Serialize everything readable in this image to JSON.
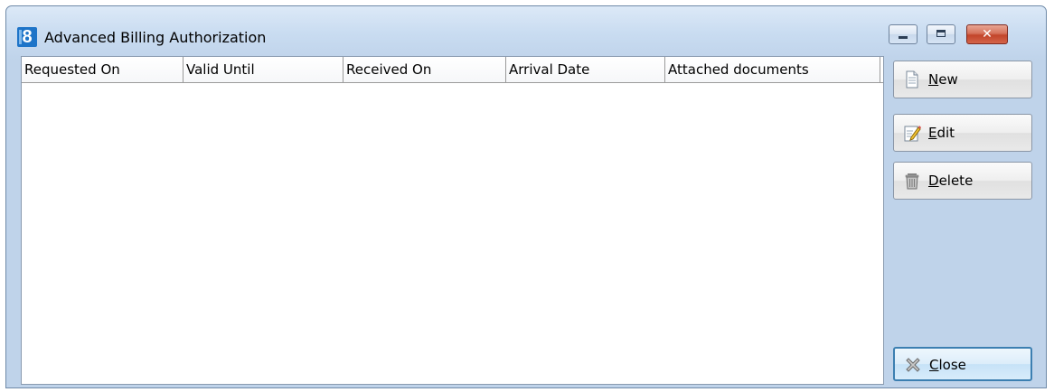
{
  "window": {
    "app_icon_glyph": "8",
    "title": "Advanced Billing Authorization",
    "controls": {
      "minimize_icon": "minimize-icon",
      "maximize_icon": "maximize-icon",
      "close_glyph": "✕"
    }
  },
  "table": {
    "columns": [
      "Requested On",
      "Valid Until",
      "Received On",
      "Arrival Date",
      "Attached documents"
    ],
    "rows": []
  },
  "buttons": {
    "new": {
      "mnemonic": "N",
      "rest": "ew",
      "icon": "document-icon"
    },
    "edit": {
      "mnemonic": "E",
      "rest": "dit",
      "icon": "edit-pencil-icon"
    },
    "delete": {
      "mnemonic": "D",
      "rest": "elete",
      "icon": "trash-icon"
    },
    "close": {
      "mnemonic": "C",
      "rest": "lose",
      "icon": "close-x-icon"
    }
  },
  "colors": {
    "window_frame": "#bfd3ea",
    "close_button": "#c2442a",
    "default_button_border": "#3c7fb1",
    "app_icon": "#1e74c8"
  }
}
